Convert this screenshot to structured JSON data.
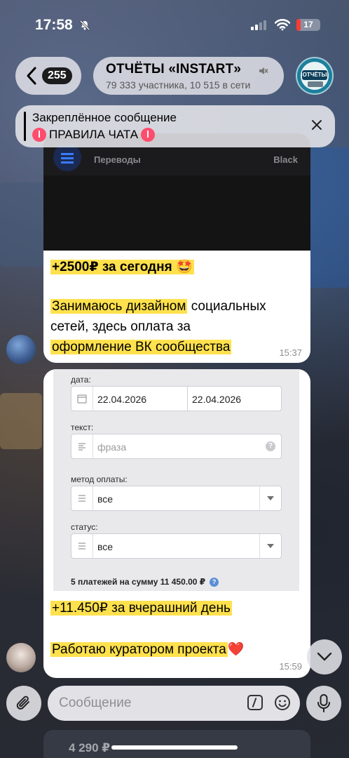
{
  "status": {
    "time": "17:58",
    "battery": "17"
  },
  "header": {
    "back_count": "255",
    "title": "ОТЧЁТЫ «INSTART»",
    "subtitle": "79 333 участника, 10 515 в сети",
    "avatar_label": "ОТЧЁТЫ"
  },
  "pinned": {
    "title": "Закреплённое сообщение",
    "text": "ПРАВИЛА ЧАТА"
  },
  "message1": {
    "bank_name": "Переводы",
    "card_name": "Black",
    "line1": "+2500₽ за сегодня 🤩",
    "line2_hl": "Занимаюсь дизайном",
    "line2_rest": " социальных",
    "line3": "сетей, здесь оплата за",
    "line4": "оформление ВК сообщества",
    "time": "15:37"
  },
  "message2": {
    "form": {
      "date_label": "дата:",
      "date_from": "22.04.2026",
      "date_to": "22.04.2026",
      "text_label": "текст:",
      "text_placeholder": "фраза",
      "method_label": "метод оплаты:",
      "method_value": "все",
      "status_label": "статус:",
      "status_value": "все",
      "summary": "5 платежей на сумму 11 450.00 ₽"
    },
    "line1": "+11.450₽ за вчерашний день",
    "line2": "Работаю куратором проекта",
    "line2_emoji": "❤️",
    "time": "15:59"
  },
  "composer": {
    "placeholder": "Сообщение"
  },
  "peek": {
    "text": "4 290 ₽"
  }
}
